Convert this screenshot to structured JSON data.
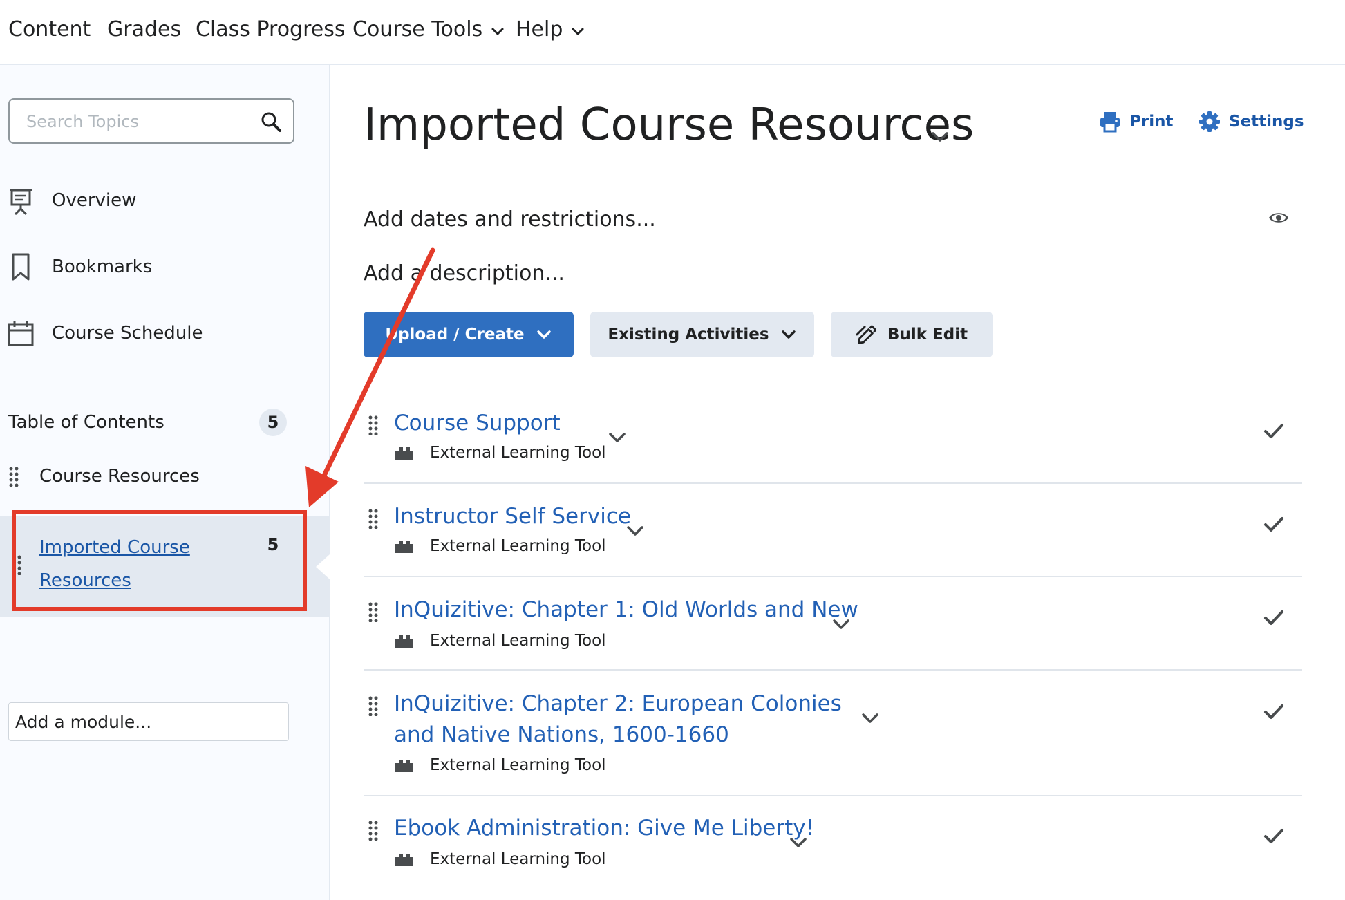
{
  "topnav": {
    "items": [
      {
        "label": "Content"
      },
      {
        "label": "Grades"
      },
      {
        "label": "Class Progress"
      },
      {
        "label": "Course Tools",
        "icon": "chevron-down-icon"
      },
      {
        "label": "Help",
        "icon": "chevron-down-icon"
      }
    ]
  },
  "sidebar": {
    "search": {
      "placeholder": "Search Topics",
      "value": "",
      "icon": "search-icon"
    },
    "links": [
      {
        "label": "Overview",
        "icon": "presentation-icon"
      },
      {
        "label": "Bookmarks",
        "icon": "bookmark-icon"
      },
      {
        "label": "Course Schedule",
        "icon": "calendar-icon"
      }
    ],
    "toc": {
      "label": "Table of Contents",
      "count": "5"
    },
    "module": {
      "label": "Course Resources"
    },
    "submodule": {
      "label": "Imported Course Resources",
      "count": "5"
    },
    "add_module": "Add a module..."
  },
  "main": {
    "title": "Imported Course Resources",
    "actions": [
      {
        "label": "Print",
        "icon": "printer-icon"
      },
      {
        "label": "Settings",
        "icon": "gear-icon"
      }
    ],
    "dates_text": "Add dates and restrictions...",
    "description_text": "Add a description...",
    "buttons": {
      "upload": "Upload / Create",
      "existing": "Existing Activities",
      "bulk": "Bulk Edit"
    },
    "items": [
      {
        "title": "Course Support",
        "type": "External Learning Tool"
      },
      {
        "title": "Instructor Self Service",
        "type": "External Learning Tool"
      },
      {
        "title": "InQuizitive: Chapter 1: Old Worlds and New",
        "type": "External Learning Tool"
      },
      {
        "title": "InQuizitive: Chapter 2: European Colonies and Native Nations, 1600-1660",
        "type": "External Learning Tool"
      },
      {
        "title": "Ebook Administration: Give Me Liberty!",
        "type": "External Learning Tool"
      }
    ]
  },
  "colors": {
    "accent": "#2f6fc0",
    "link": "#2260b5",
    "annotation": "#e33b2a",
    "selected_bg": "#e3e9f1"
  }
}
